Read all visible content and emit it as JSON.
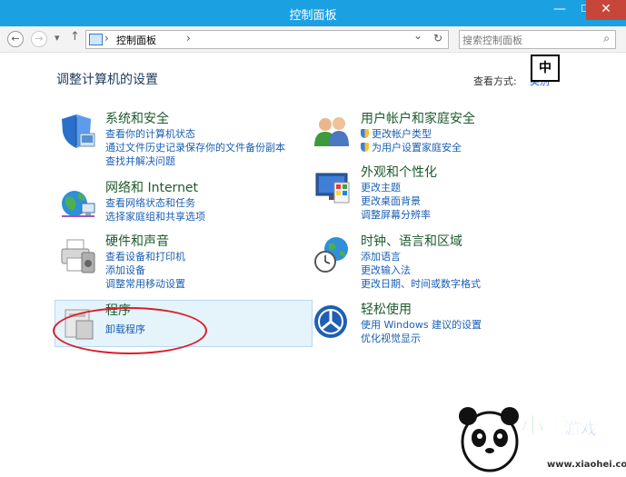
{
  "window": {
    "title": "控制面板",
    "min": "—",
    "max": "☐",
    "close": "✕"
  },
  "toolbar": {
    "back": "←",
    "forward": "→",
    "recent": "▾",
    "up": "↑",
    "address": "控制面板",
    "chevron": "›",
    "dropdown": "⌄",
    "refresh": "↻",
    "search_placeholder": "搜索控制面板",
    "search_icon": "⌕"
  },
  "main": {
    "heading": "调整计算机的设置",
    "view_by_label": "查看方式:",
    "view_by_value": "类别",
    "ime_indicator": "中"
  },
  "categories": [
    {
      "title": "系统和安全",
      "links": [
        "查看你的计算机状态",
        "通过文件历史记录保存你的文件备份副本",
        "查找并解决问题"
      ]
    },
    {
      "title": "网络和 Internet",
      "links": [
        "查看网络状态和任务",
        "选择家庭组和共享选项"
      ]
    },
    {
      "title": "硬件和声音",
      "links": [
        "查看设备和打印机",
        "添加设备",
        "调整常用移动设置"
      ]
    },
    {
      "title": "程序",
      "links": [
        "卸载程序"
      ]
    },
    {
      "title": "用户帐户和家庭安全",
      "links": [
        "更改帐户类型",
        "为用户设置家庭安全"
      ]
    },
    {
      "title": "外观和个性化",
      "links": [
        "更改主题",
        "更改桌面背景",
        "调整屏幕分辨率"
      ]
    },
    {
      "title": "时钟、语言和区域",
      "links": [
        "添加语言",
        "更改输入法",
        "更改日期、时间或数字格式"
      ]
    },
    {
      "title": "轻松使用",
      "links": [
        "使用 Windows 建议的设置",
        "优化视觉显示"
      ]
    }
  ],
  "watermark": {
    "brand": "小黑游戏",
    "url": "www.xiaohei.com"
  },
  "icons": [
    "shield-icon",
    "network-icon",
    "printer-icon",
    "programs-icon",
    "users-icon",
    "personalization-icon",
    "clock-globe-icon",
    "ease-of-access-icon"
  ]
}
